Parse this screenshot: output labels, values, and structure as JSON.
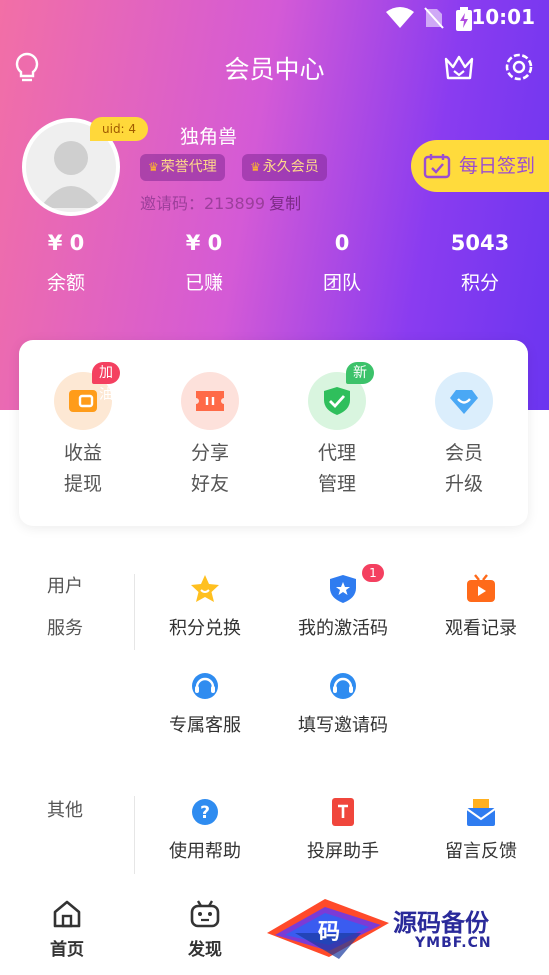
{
  "status_bar": {
    "time": "10:01"
  },
  "header": {
    "title": "会员中心"
  },
  "profile": {
    "uid_label": "uid: 4",
    "username": "独角兽",
    "tags": [
      "荣誉代理",
      "永久会员"
    ],
    "invite_label": "邀请码：213899",
    "copy_label": "复制",
    "checkin_label": "每日签到"
  },
  "stats": [
    {
      "value": "¥ 0",
      "label": "余额"
    },
    {
      "value": "¥ 0",
      "label": "已赚"
    },
    {
      "value": "0",
      "label": "团队"
    },
    {
      "value": "5043",
      "label": "积分"
    }
  ],
  "quick_actions": [
    {
      "line1": "收益",
      "line2": "提现",
      "badge": "加油"
    },
    {
      "line1": "分享",
      "line2": "好友"
    },
    {
      "line1": "代理",
      "line2": "管理",
      "badge": "新"
    },
    {
      "line1": "会员",
      "line2": "升级"
    }
  ],
  "user_services": {
    "label_line1": "用户",
    "label_line2": "服务",
    "items": [
      {
        "label": "积分兑换"
      },
      {
        "label": "我的激活码",
        "badge": "1"
      },
      {
        "label": "观看记录"
      },
      {
        "label": "专属客服"
      },
      {
        "label": "填写邀请码"
      }
    ]
  },
  "other": {
    "label": "其他",
    "items": [
      {
        "label": "使用帮助"
      },
      {
        "label": "投屏助手"
      },
      {
        "label": "留言反馈"
      }
    ]
  },
  "nav": {
    "items": [
      {
        "label": "首页"
      },
      {
        "label": "发现"
      }
    ]
  },
  "watermark": {
    "glyph": "码",
    "cn": "源码备份",
    "en": "YMBF.CN"
  },
  "colors": {
    "accent": "#8a3cf0",
    "gold": "#ffd83a",
    "badge_red": "#f44060",
    "badge_green": "#3cc26a"
  }
}
